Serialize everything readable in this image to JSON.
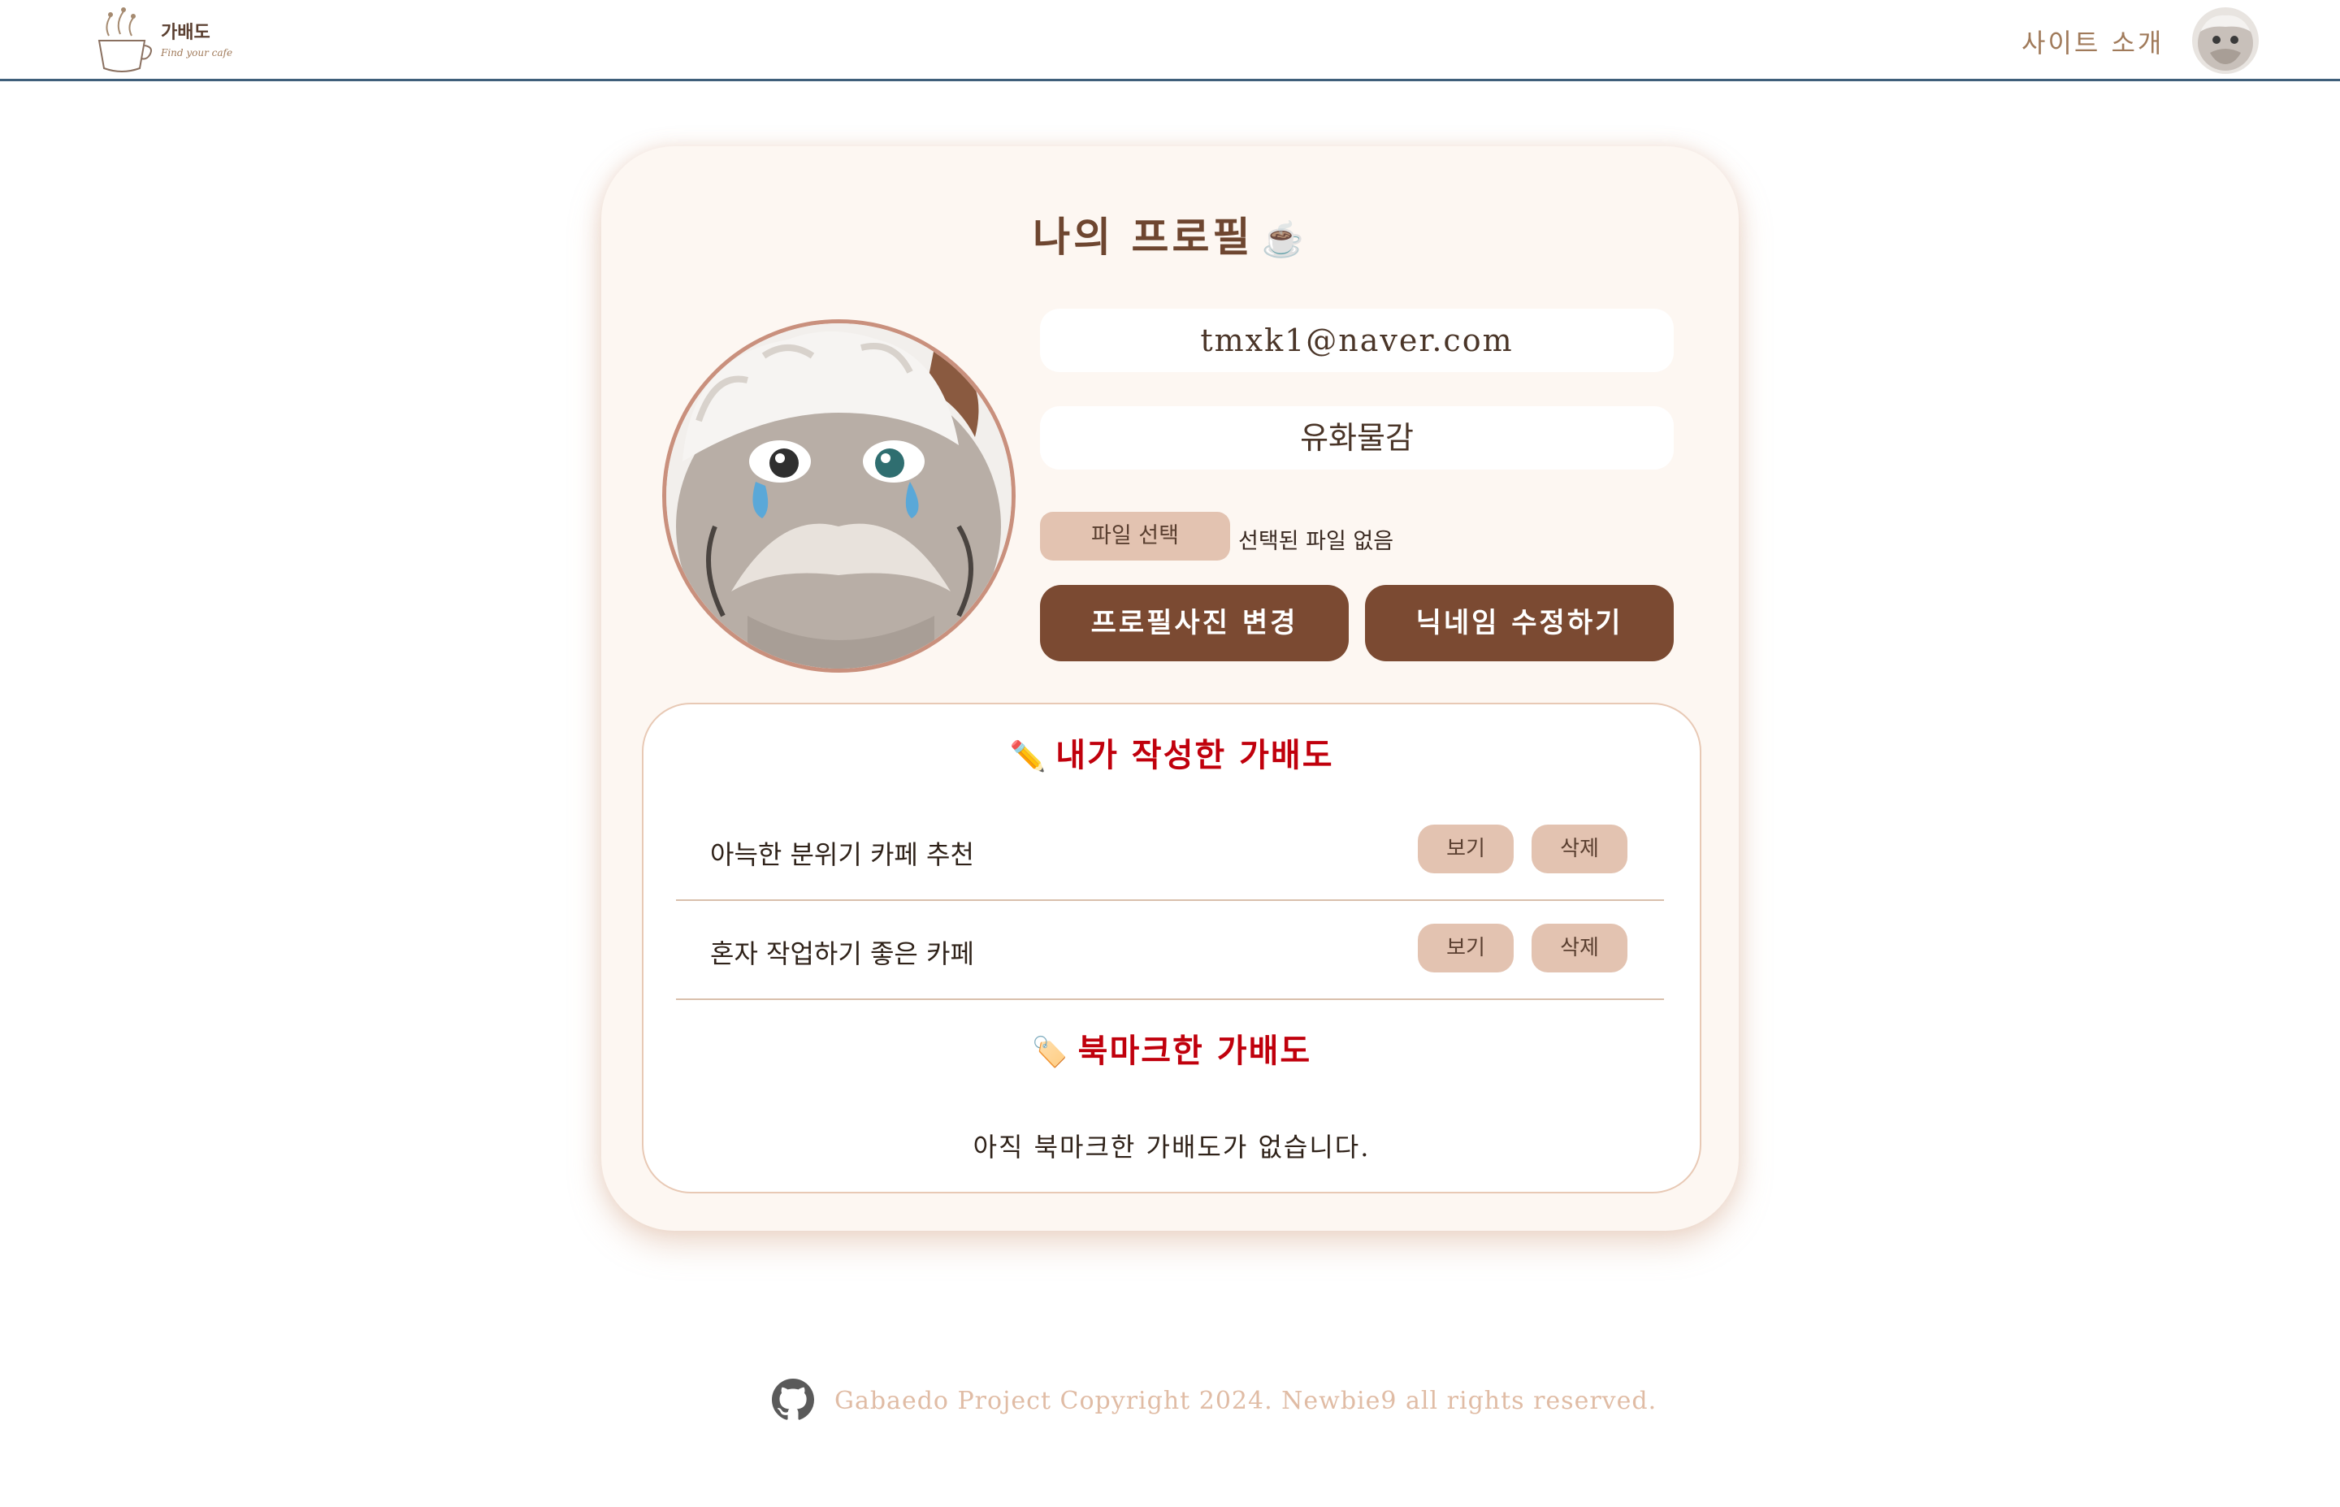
{
  "header": {
    "logo_title": "가배도",
    "logo_subtitle": "Find your cafe",
    "nav_about": "사이트 소개"
  },
  "profile": {
    "title": "나의 프로필",
    "title_icon": "coffee-cup-icon",
    "title_icon_glyph": "☕",
    "email": "tmxk1@naver.com",
    "nickname": "유화물감",
    "file_button": "파일 선택",
    "file_status": "선택된 파일 없음",
    "change_photo_button": "프로필사진 변경",
    "edit_nickname_button": "닉네임 수정하기"
  },
  "my_posts": {
    "title": "내가 작성한 가배도",
    "icon": "pencil-icon",
    "icon_glyph": "✏️",
    "items": [
      {
        "title": "아늑한 분위기 카페 추천",
        "view_label": "보기",
        "delete_label": "삭제"
      },
      {
        "title": "혼자 작업하기 좋은 카페",
        "view_label": "보기",
        "delete_label": "삭제"
      }
    ]
  },
  "bookmarks": {
    "title": "북마크한 가배도",
    "icon": "bookmark-tag-icon",
    "icon_glyph": "🏷️",
    "empty_message": "아직 북마크한 가배도가 없습니다."
  },
  "footer": {
    "icon": "github-icon",
    "text": "Gabaedo Project Copyright 2024.  Newbie9 all rights reserved."
  },
  "colors": {
    "accent_brown": "#7b4a32",
    "button_tan": "#e3c3b1",
    "section_red": "#c0000c",
    "card_bg": "#fdf7f2",
    "header_border": "#3f5f7a"
  }
}
